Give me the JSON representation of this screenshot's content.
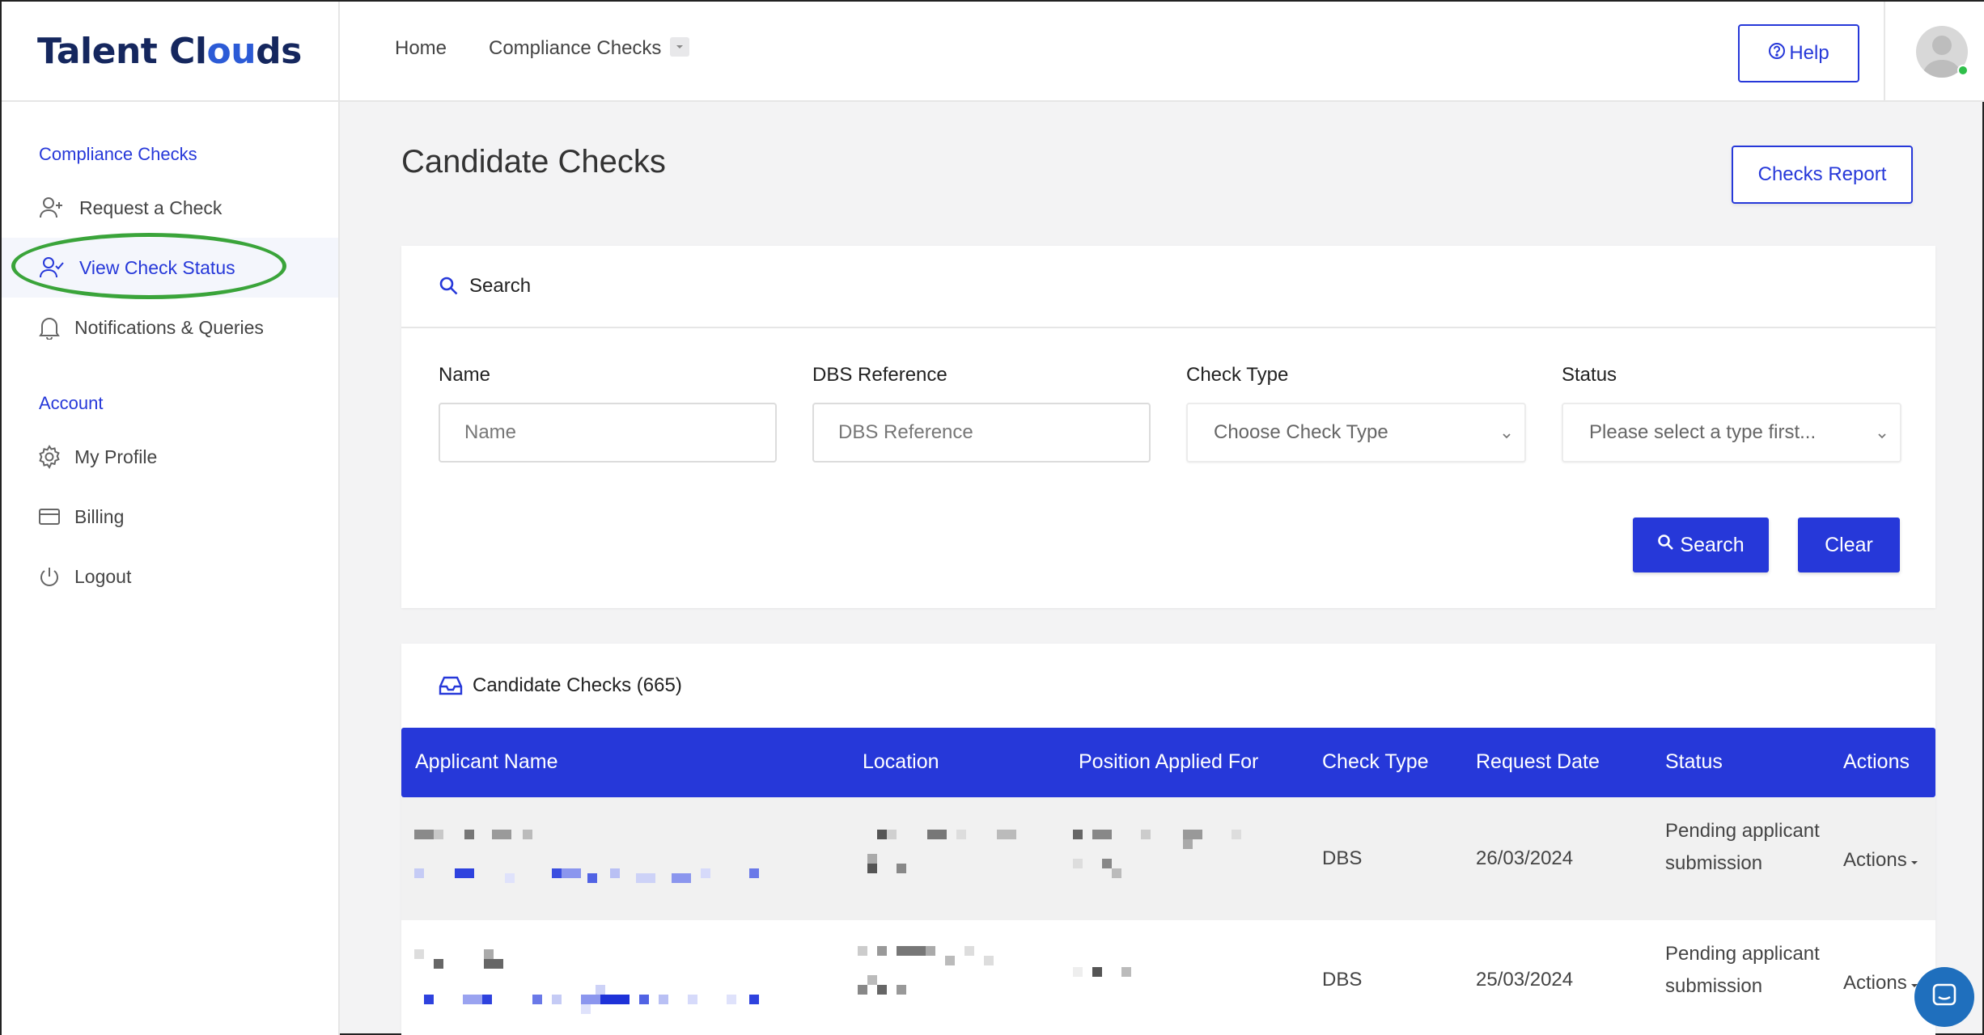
{
  "brand": {
    "name_part1": "Talent Cl",
    "name_oo": "ou",
    "name_part2": "ds"
  },
  "topnav": {
    "home": "Home",
    "compliance": "Compliance Checks",
    "help": "Help"
  },
  "sidebar": {
    "section_checks": "Compliance Checks",
    "items_checks": [
      {
        "label": "Request a Check",
        "icon": "user-plus-icon"
      },
      {
        "label": "View Check Status",
        "icon": "user-check-icon",
        "active": true
      },
      {
        "label": "Notifications & Queries",
        "icon": "bell-icon"
      }
    ],
    "section_account": "Account",
    "items_account": [
      {
        "label": "My Profile",
        "icon": "gear-icon"
      },
      {
        "label": "Billing",
        "icon": "credit-card-icon"
      },
      {
        "label": "Logout",
        "icon": "power-icon"
      }
    ]
  },
  "page": {
    "title": "Candidate Checks",
    "report_button": "Checks Report"
  },
  "search": {
    "title": "Search",
    "name_label": "Name",
    "name_placeholder": "Name",
    "dbs_label": "DBS Reference",
    "dbs_placeholder": "DBS Reference",
    "check_type_label": "Check Type",
    "check_type_value": "Choose Check Type",
    "status_label": "Status",
    "status_value": "Please select a type first...",
    "search_button": "Search",
    "clear_button": "Clear"
  },
  "table": {
    "title": "Candidate Checks (665)",
    "columns": [
      "Applicant Name",
      "Location",
      "Position Applied For",
      "Check Type",
      "Request Date",
      "Status",
      "Actions"
    ],
    "rows": [
      {
        "check_type": "DBS",
        "request_date": "26/03/2024",
        "status": "Pending applicant submission",
        "actions": "Actions"
      },
      {
        "check_type": "DBS",
        "request_date": "25/03/2024",
        "status": "Pending applicant submission",
        "actions": "Actions"
      }
    ]
  },
  "colors": {
    "accent": "#2638d9",
    "brand": "#15275e",
    "highlight_ring": "#3aa43a",
    "online": "#2fbf4a"
  }
}
